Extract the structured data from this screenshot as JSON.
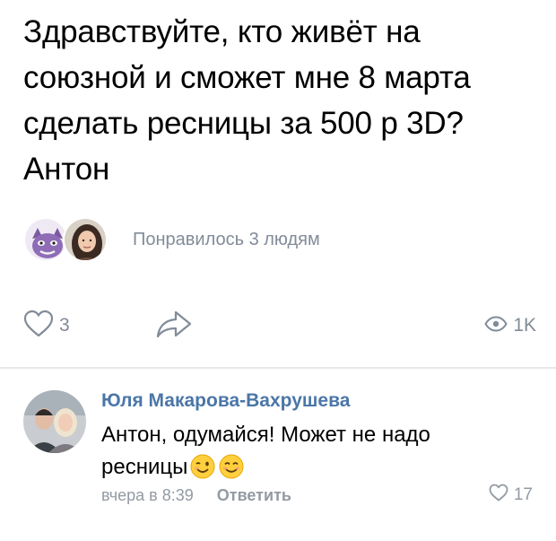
{
  "post": {
    "text_lines": [
      "Здравствуйте, кто живёт на",
      "союзной и сможет мне 8 марта",
      "сделать ресницы за 500 р 3D?",
      "Антон"
    ],
    "likers_text": "Понравилось 3 людям",
    "like_count": "3",
    "views_count": "1K",
    "icons": {
      "like": "heart-icon",
      "share": "share-arrow-icon",
      "views": "eye-icon"
    }
  },
  "comment": {
    "author": "Юля Макарова-Вахрушева",
    "text_lines": [
      "Антон, одумайся! Может не надо",
      "ресницы"
    ],
    "emojis": [
      "winking-face-emoji",
      "smiling-face-emoji"
    ],
    "date": "вчера в 8:39",
    "reply_label": "Ответить",
    "like_count": "17"
  },
  "colors": {
    "muted_text": "#818c99",
    "author_link": "#4a76a8",
    "divider": "#e7e8ec"
  }
}
